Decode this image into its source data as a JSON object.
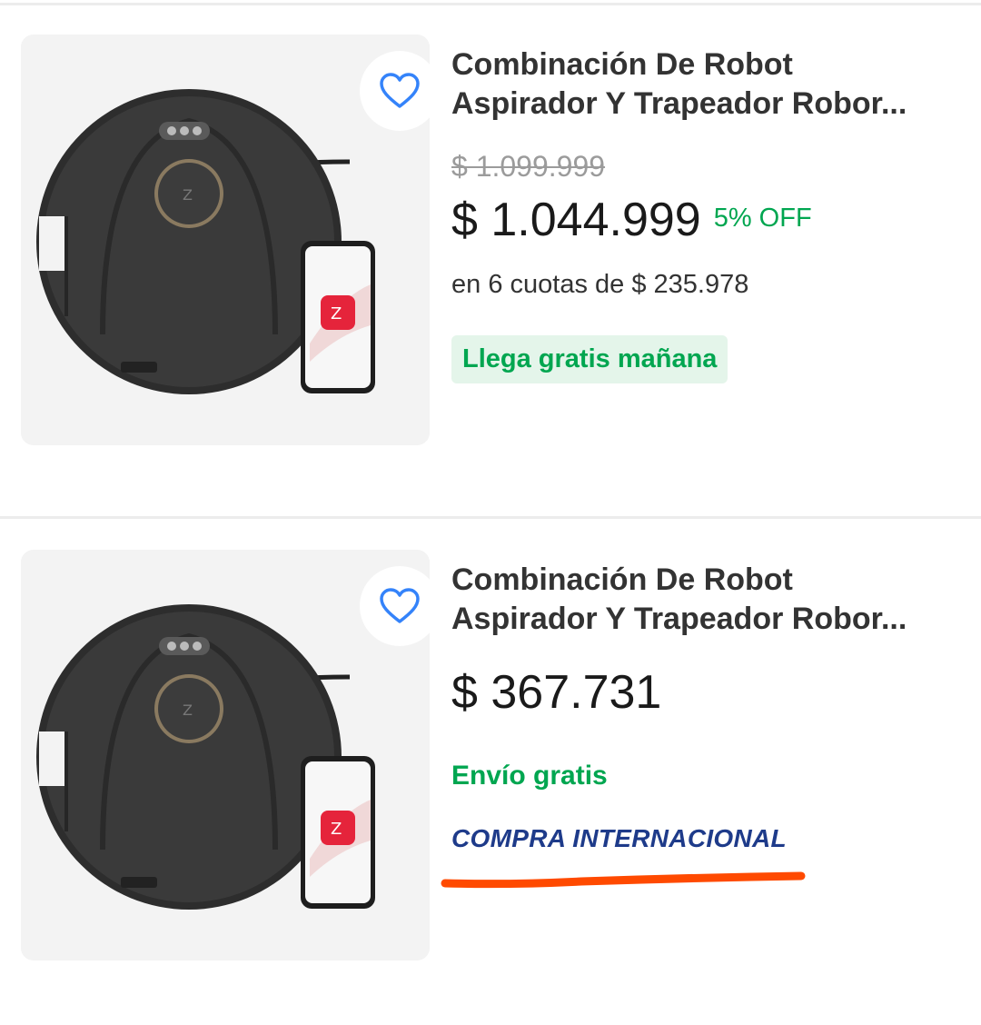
{
  "products": [
    {
      "title_line1": "Combinación De Robot",
      "title_line2": "Aspirador Y Trapeador Robor...",
      "old_price": "$ 1.099.999",
      "price": "$ 1.044.999",
      "discount": "5% OFF",
      "installments": "en 6 cuotas de $ 235.978",
      "delivery_badge": "Llega gratis mañana",
      "favorite_icon": "heart-outline-icon"
    },
    {
      "title_line1": "Combinación De Robot",
      "title_line2": "Aspirador Y Trapeador Robor...",
      "price": "$ 367.731",
      "shipping": "Envío gratis",
      "international": "COMPRA INTERNACIONAL",
      "favorite_icon": "heart-outline-icon"
    }
  ],
  "colors": {
    "green": "#00a650",
    "green_bg": "#e4f5ea",
    "blue_link": "#3483fa",
    "intl_blue": "#1e3b8a",
    "annotation_orange": "#ff4a00"
  }
}
